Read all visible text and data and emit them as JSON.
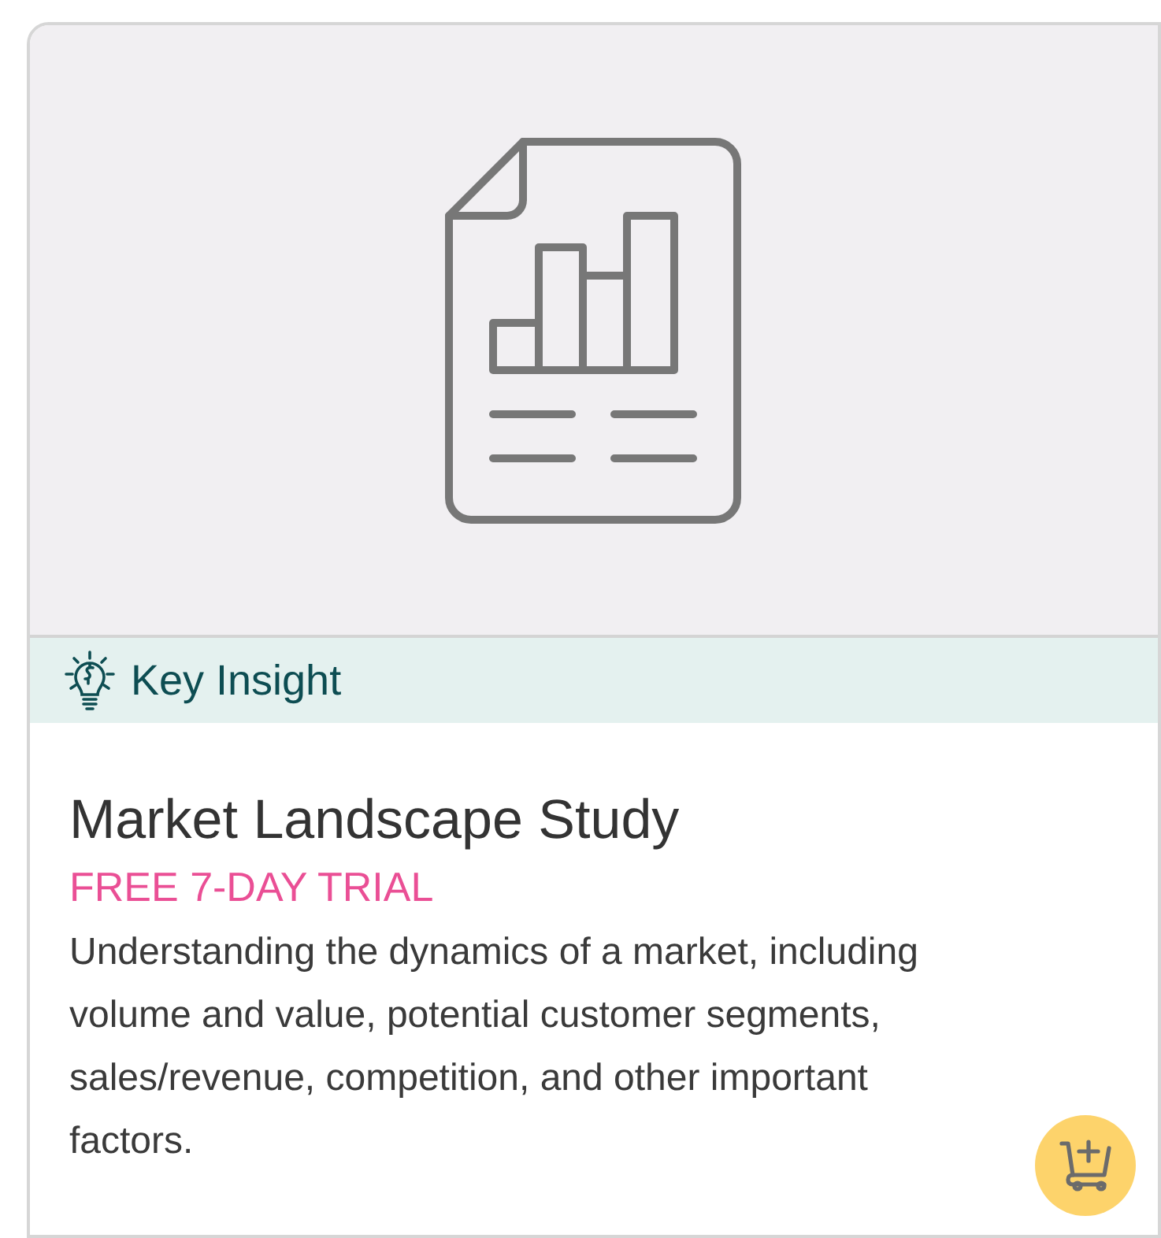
{
  "card": {
    "media": {
      "kind": "report-icon"
    },
    "tag": {
      "label": "Key Insight"
    },
    "title": "Market Landscape Study",
    "offer": "FREE 7-DAY TRIAL",
    "description": "Understanding the dynamics of a market, including volume and value, potential customer segments, sales/revenue, competition, and other important factors.",
    "cart_button": {
      "kind": "add-to-cart"
    }
  }
}
